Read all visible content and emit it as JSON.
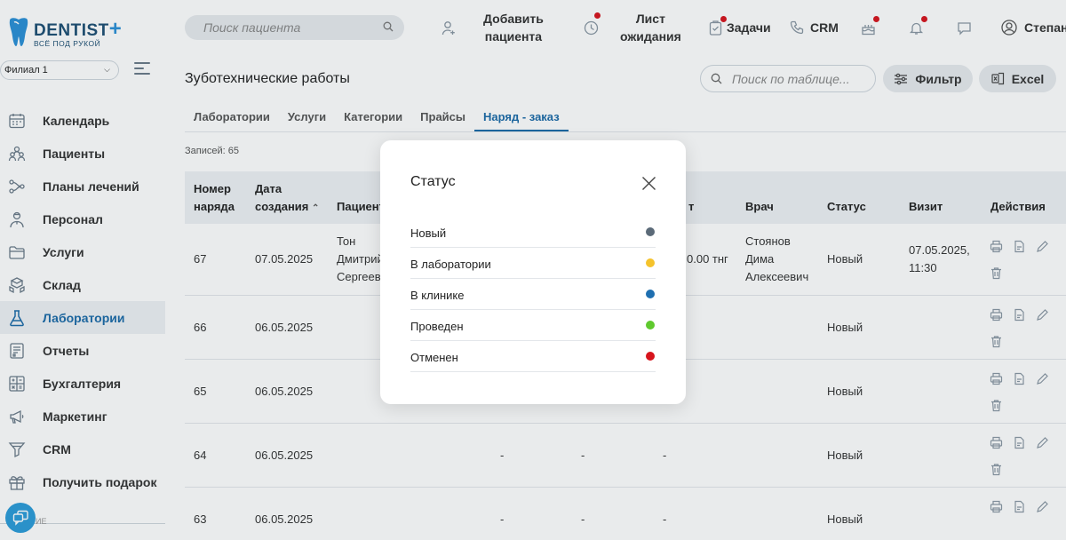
{
  "logo": {
    "title": "DENTIST",
    "plus": "+",
    "subtitle": "ВСЁ ПОД РУКОЙ"
  },
  "branch": {
    "selected": "Филиал 1"
  },
  "sidebar": {
    "items": [
      {
        "label": "Календарь",
        "icon": "calendar-icon"
      },
      {
        "label": "Пациенты",
        "icon": "patients-icon"
      },
      {
        "label": "Планы лечений",
        "icon": "treatment-plans-icon"
      },
      {
        "label": "Персонал",
        "icon": "staff-icon"
      },
      {
        "label": "Услуги",
        "icon": "folder-icon"
      },
      {
        "label": "Склад",
        "icon": "warehouse-icon"
      },
      {
        "label": "Лаборатории",
        "icon": "flask-icon",
        "active": true
      },
      {
        "label": "Отчеты",
        "icon": "report-icon"
      },
      {
        "label": "Бухгалтерия",
        "icon": "calculator-icon"
      },
      {
        "label": "Маркетинг",
        "icon": "megaphone-icon"
      },
      {
        "label": "CRM",
        "icon": "funnel-icon"
      },
      {
        "label": "Получить подарок",
        "icon": "gift-icon"
      }
    ],
    "bottom_text": "ИЕ"
  },
  "header": {
    "search_placeholder": "Поиск пациента",
    "add_patient": "Добавить пациента",
    "add_patient_l1": "Добавить",
    "add_patient_l2": "пациента",
    "waitlist_l1": "Лист",
    "waitlist_l2": "ожидания",
    "tasks": "Задачи",
    "crm": "CRM",
    "user": "Степан"
  },
  "page": {
    "title": "Зуботехнические работы",
    "table_search_placeholder": "Поиск по таблице...",
    "filter_label": "Фильтр",
    "excel_label": "Excel",
    "records_label": "Записей: 65"
  },
  "tabs": [
    {
      "label": "Лаборатории"
    },
    {
      "label": "Услуги"
    },
    {
      "label": "Категории"
    },
    {
      "label": "Прайсы"
    },
    {
      "label": "Наряд - заказ",
      "active": true
    }
  ],
  "table": {
    "headers": {
      "order_num_l1": "Номер",
      "order_num_l2": "наряда",
      "created_l1": "Дата",
      "created_l2": "создания",
      "patient": "Пациент",
      "price_tail": "т",
      "doctor": "Врач",
      "status": "Статус",
      "visit": "Визит",
      "actions": "Действия"
    },
    "rows": [
      {
        "num": "67",
        "date": "07.05.2025",
        "patient_l1": "Тон",
        "patient_l2": "Дмитрий",
        "patient_l3": "Сергееви",
        "amount": "0.00 тнг",
        "doctor_l1": "Стоянов",
        "doctor_l2": "Дима",
        "doctor_l3": "Алексеевич",
        "status": "Новый",
        "visit_l1": "07.05.2025,",
        "visit_l2": "11:30"
      },
      {
        "num": "66",
        "date": "06.05.2025",
        "status": "Новый"
      },
      {
        "num": "65",
        "date": "06.05.2025",
        "status": "Новый"
      },
      {
        "num": "64",
        "date": "06.05.2025",
        "c1": "-",
        "c2": "-",
        "c3": "-",
        "status": "Новый"
      },
      {
        "num": "63",
        "date": "06.05.2025",
        "c1": "-",
        "c2": "-",
        "c3": "-",
        "status": "Новый"
      }
    ]
  },
  "modal": {
    "title": "Статус",
    "statuses": [
      {
        "label": "Новый",
        "color": "#5b6a78"
      },
      {
        "label": "В лаборатории",
        "color": "#f5c32c"
      },
      {
        "label": "В клинике",
        "color": "#1f6fb0"
      },
      {
        "label": "Проведен",
        "color": "#5fc92e"
      },
      {
        "label": "Отменен",
        "color": "#d7141c"
      }
    ]
  },
  "colors": {
    "accent": "#1b6aa8",
    "badge_red": "#d7141c",
    "help_bubble": "#2b9bd8"
  }
}
